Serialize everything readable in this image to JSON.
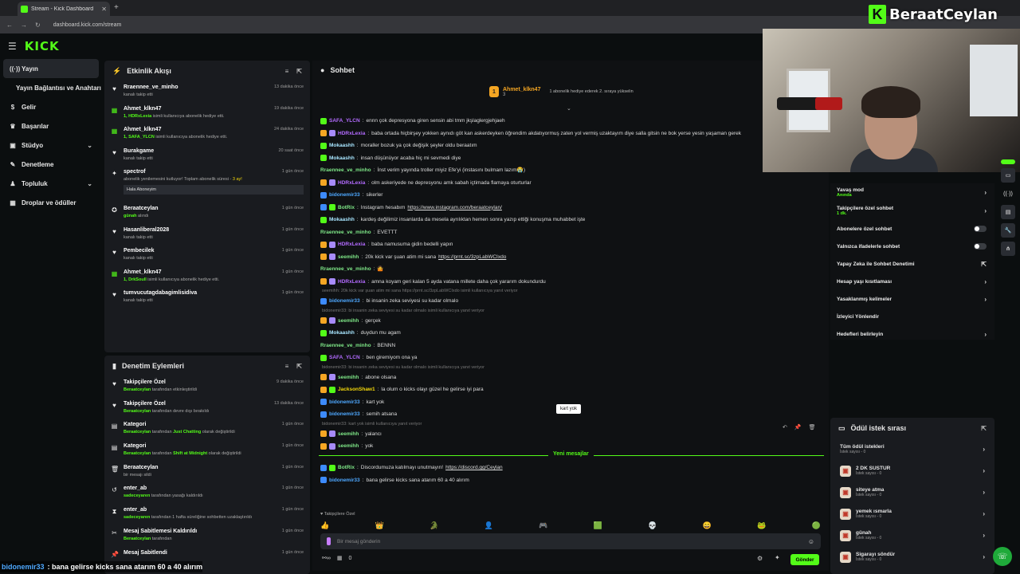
{
  "browser": {
    "tab_title": "Stream - Kick Dashboard",
    "url": "dashboard.kick.com/stream"
  },
  "header": {
    "logo": "KICK"
  },
  "sidebar": {
    "items": [
      {
        "label": "Yayın",
        "icon": "broadcast-icon",
        "active": true
      },
      {
        "label": "Yayın Bağlantısı ve Anahtarı",
        "icon": ""
      },
      {
        "label": "Gelir",
        "icon": "money-icon"
      },
      {
        "label": "Başarılar",
        "icon": "trophy-icon"
      },
      {
        "label": "Stüdyo",
        "icon": "studio-icon",
        "chevron": true
      },
      {
        "label": "Denetleme",
        "icon": "wrench-icon"
      },
      {
        "label": "Topluluk",
        "icon": "community-icon",
        "chevron": true
      },
      {
        "label": "Droplar ve ödüller",
        "icon": "gift-icon"
      }
    ]
  },
  "activity": {
    "title": "Etkinlik Akışı",
    "items": [
      {
        "name": "Rraennee_ve_minho",
        "sub": "kanalı takip etti",
        "time": "13 dakika önce",
        "icon": "heart-icon"
      },
      {
        "name": "Ahmet_klkn47",
        "sub_hl": "1, HDRxLexia",
        "sub": " isimli kullanıcıya abonelik hediye etti.",
        "time": "19 dakika önce",
        "icon": "gift-icon"
      },
      {
        "name": "Ahmet_klkn47",
        "sub_hl": "1, SAFA_YLCN",
        "sub": " isimli kullanıcıya abonelik hediye etti.",
        "time": "24 dakika önce",
        "icon": "gift-icon"
      },
      {
        "name": "Burakgame",
        "sub": "kanalı takip etti",
        "time": "20 saat önce",
        "icon": "heart-icon"
      },
      {
        "name": "spectrof",
        "sub": "abonelik yenilemesini kutluyor! Toplam abonelik süresi - ",
        "sub_tail": "3 ay!",
        "box": "Hala Aboneyim",
        "time": "1 gün önce",
        "icon": "star-icon"
      },
      {
        "name": "Beraatceylan",
        "sub_hl": "günah",
        "sub": " alındı",
        "time": "1 gün önce",
        "icon": "reward-icon"
      },
      {
        "name": "Hasanliberal2028",
        "sub": "kanalı takip etti",
        "time": "1 gün önce",
        "icon": "heart-icon"
      },
      {
        "name": "Pembecilek",
        "sub": "kanalı takip etti",
        "time": "1 gün önce",
        "icon": "heart-icon"
      },
      {
        "name": "Ahmet_klkn47",
        "sub_hl": "1, DrkSoull",
        "sub": " isimli kullanıcıya abonelik hediye etti.",
        "time": "1 gün önce",
        "icon": "gift-icon"
      },
      {
        "name": "tumvucutagdabagimlisidiva",
        "sub": "kanalı takip etti",
        "time": "1 gün önce",
        "icon": "heart-icon"
      }
    ]
  },
  "moderation": {
    "title": "Denetim Eylemleri",
    "items": [
      {
        "name": "Takipçilere Özel",
        "sub_hl": "Beraatceylan",
        "sub": " tarafından etkinleştirildi",
        "time": "9 dakika önce",
        "icon": "heart-icon"
      },
      {
        "name": "Takipçilere Özel",
        "sub_hl": "Beraatceylan",
        "sub": " tarafından devre dışı bırakıldı",
        "time": "13 dakika önce",
        "icon": "heart-icon"
      },
      {
        "name": "Kategori",
        "sub_hl": "Beraatceylan",
        "sub": " tarafından ",
        "sub_hl2": "Just Chatting",
        "sub2": " olarak değiştirildi",
        "time": "1 gün önce",
        "icon": "category-icon"
      },
      {
        "name": "Kategori",
        "sub_hl": "Beraatceylan",
        "sub": " tarafından ",
        "sub_hl2": "Shift at Midnight",
        "sub2": " olarak değiştirildi",
        "time": "1 gün önce",
        "icon": "category-icon"
      },
      {
        "name": "Beraatceylan",
        "sub": "bir mesajı sildi",
        "time": "1 gün önce",
        "icon": "trash-icon"
      },
      {
        "name": "enter_ab",
        "sub_hl": "sadeceyaren",
        "sub": " tarafından yasağı kaldırıldı",
        "time": "1 gün önce",
        "icon": "undo-icon"
      },
      {
        "name": "enter_ab",
        "sub_hl": "sadeceyaren",
        "sub": " tarafından 1 hafta süreliğine sohbetten uzaklaştırıldı",
        "time": "1 gün önce",
        "icon": "hourglass-icon"
      },
      {
        "name": "Mesaj Sabitlemesi Kaldırıldı",
        "sub_hl": "Beraatceylan",
        "sub": " tarafından",
        "time": "1 gün önce",
        "icon": "unpin-icon"
      },
      {
        "name": "Mesaj Sabitlendi",
        "sub": "",
        "time": "1 gün önce",
        "icon": "pin-icon"
      }
    ]
  },
  "chat": {
    "title": "Sohbet",
    "pinned": {
      "user": "Ahmet_klkn47",
      "count": "3",
      "text": "1 abonelik hediye ederek 2. sıraya yükselin"
    },
    "messages": [
      {
        "user": "SAFA_YLCN",
        "color": "#b36bff",
        "text": "ennn çok depresyona giren sensin abi tmm jkşlaglergjehjaeh",
        "badges": [
          "#53fc18"
        ]
      },
      {
        "user": "HDRxLexia",
        "color": "#b36bff",
        "text": "baba ortada hiçbirşey yokken aynıdı göt kan askerdeyken öğrendim akdatıyormuş zaten yol vermiş uzaktayım diye salla gitsin ne bok yerse yesin yaşaman gerek",
        "badges": [
          "#f5a623",
          "#a78bfa"
        ]
      },
      {
        "user": "Mokaashh",
        "color": "#a8e6ff",
        "text": "moraller bozuk ya çok değişik şeyler oldu beraatım",
        "badges": [
          "#53fc18"
        ]
      },
      {
        "user": "Mokaashh",
        "color": "#a8e6ff",
        "text": "insan düşünüyor acaba hiç mi sevmedi diye",
        "badges": [
          "#53fc18"
        ]
      },
      {
        "user": "Rraennee_ve_minho",
        "color": "#7ee787",
        "text": "İnst verim yayında troller miyiz Efe'yi (instasını bulmam lazım😭)",
        "badges": []
      },
      {
        "user": "HDRxLexia",
        "color": "#b36bff",
        "text": "olm askeriyede ne depresyonu amk sabah içtimada flamaya oturturlar",
        "badges": [
          "#f5a623",
          "#a78bfa"
        ]
      },
      {
        "user": "bidonemir33",
        "color": "#4ea8ff",
        "text": "sikerler",
        "badges": [
          "#3d8bfd"
        ]
      },
      {
        "user": "BotRix",
        "color": "#7ee787",
        "text": "Instagram hesabım ",
        "link": "https://www.instagram.com/beraatceylan/",
        "badges": [
          "#3d8bfd",
          "#53fc18"
        ]
      },
      {
        "user": "Mokaashh",
        "color": "#a8e6ff",
        "text": "kardeş değilimiz insanlarda da mesela ayrılıktan hemen sonra yazıp ettiği konuşma muhabbet işte",
        "badges": [
          "#53fc18"
        ]
      },
      {
        "user": "Rraennee_ve_minho",
        "color": "#7ee787",
        "text": "EVETTT",
        "badges": []
      },
      {
        "user": "HDRxLexia",
        "color": "#b36bff",
        "text": "baba namusuma gidin bedelli yapın",
        "badges": [
          "#f5a623",
          "#a78bfa"
        ]
      },
      {
        "user": "seemihh",
        "color": "#7ee787",
        "text": "20k kick var şuan atim mi sana ",
        "link": "https://prnt.sc/3zpLabWCIxdo",
        "badges": [
          "#f5a623",
          "#a78bfa"
        ]
      },
      {
        "user": "Rraennee_ve_minho",
        "color": "#7ee787",
        "text": "🤷",
        "badges": []
      },
      {
        "user": "HDRxLexia",
        "color": "#b36bff",
        "text": "amna koyam geri kalan 5 ayda vatana millete daha çok yararım dokundurdu",
        "badges": [
          "#f5a623",
          "#a78bfa"
        ]
      },
      {
        "reply": "seemihh: 20k kick var şuan atim mi sana https://prnt.sc/3zpLabWCIxdo isimli kullanıcıya yanıt veriyor"
      },
      {
        "user": "bidonemir33",
        "color": "#4ea8ff",
        "text": "bi insanin zeka seviyesi su kadar olmalo",
        "badges": [
          "#3d8bfd"
        ]
      },
      {
        "reply": "bidonemir33: bi insanin zeka seviyesi su kadar olmalo isimli kullanıcıya yanıt veriyor"
      },
      {
        "user": "seemihh",
        "color": "#7ee787",
        "text": "gerçek",
        "badges": [
          "#f5a623",
          "#a78bfa"
        ]
      },
      {
        "user": "Mokaashh",
        "color": "#a8e6ff",
        "text": "duydun mu agam",
        "badges": [
          "#53fc18"
        ]
      },
      {
        "user": "Rraennee_ve_minho",
        "color": "#7ee787",
        "text": "BENNN",
        "badges": []
      },
      {
        "user": "SAFA_YLCN",
        "color": "#b36bff",
        "text": "ben giremiyom ona ya",
        "badges": [
          "#53fc18"
        ]
      },
      {
        "reply": "bidonemir33: bi insanin zeka seviyesi su kadar olmalo isimli kullanıcıya yanıt veriyor"
      },
      {
        "user": "seemihh",
        "color": "#7ee787",
        "text": "abone olsana",
        "badges": [
          "#f5a623",
          "#a78bfa"
        ]
      },
      {
        "user": "JacksonShaw1",
        "color": "#f5d90a",
        "text": "la olum o kicks olayı güzel he gelirse iyi para",
        "badges": [
          "#f5a623",
          "#53fc18"
        ]
      },
      {
        "user": "bidonemir33",
        "color": "#4ea8ff",
        "text": "kart yok",
        "badges": [
          "#3d8bfd"
        ]
      },
      {
        "user": "bidonemir33",
        "color": "#4ea8ff",
        "text": "semih atsana",
        "badges": [
          "#3d8bfd"
        ]
      },
      {
        "reply": "bidonemir33: kart yok isimli kullanıcıya yanıt veriyor"
      },
      {
        "user": "seemihh",
        "color": "#7ee787",
        "text": "yalancı",
        "badges": [
          "#f5a623",
          "#a78bfa"
        ]
      },
      {
        "user": "seemihh",
        "color": "#7ee787",
        "text": "yok",
        "badges": [
          "#f5a623",
          "#a78bfa"
        ]
      }
    ],
    "tooltip": "kart yok",
    "new_messages": "Yeni mesajlar",
    "after": [
      {
        "user": "BotRix",
        "color": "#7ee787",
        "text": "Discordumuza katılmayı unutmayın! ",
        "link": "https://discord.gg/Ceylan",
        "badges": [
          "#3d8bfd",
          "#53fc18"
        ]
      },
      {
        "user": "bidonemir33",
        "color": "#4ea8ff",
        "text": "bana gelirse kicks sana atarım 60 a 40 alırım",
        "badges": [
          "#3d8bfd"
        ]
      }
    ],
    "mode_label": "Takipçilere Özel",
    "placeholder": "Bir mesaj gönderin",
    "send": "Gönder",
    "footer_count": "0"
  },
  "settings": {
    "items": [
      {
        "label": "Yavaş mod",
        "sub": "Anında",
        "type": "chevron"
      },
      {
        "label": "Takipçilere özel sohbet",
        "sub": "1 dk.",
        "type": "chevron"
      },
      {
        "label": "Abonelere özel sohbet",
        "type": "toggle"
      },
      {
        "label": "Yalnızca ifadelerle sohbet",
        "type": "toggle"
      },
      {
        "label": "Yapay Zeka ile Sohbet Denetimi",
        "type": "external"
      },
      {
        "label": "Hesap yaşı kısıtlaması",
        "type": "chevron"
      },
      {
        "label": "Yasaklanmış kelimeler",
        "type": "chevron"
      },
      {
        "label": "İzleyici Yönlendir",
        "type": "none"
      },
      {
        "label": "Hedefleri belirleyin",
        "type": "chevron"
      }
    ]
  },
  "rewards": {
    "title": "Ödül istek sırası",
    "all": "Tüm ödül istekleri",
    "all_sub": "İstek sayısı - 0",
    "items": [
      {
        "label": "2 DK SUSTUR",
        "sub": "İstek sayısı - 0"
      },
      {
        "label": "siteye atma",
        "sub": "İstek sayısı - 0"
      },
      {
        "label": "yemek ısmarla",
        "sub": "İstek sayısı - 0"
      },
      {
        "label": "günah",
        "sub": "İstek sayısı - 0"
      },
      {
        "label": "Sigarayı söndür",
        "sub": "İstek sayısı - 0"
      }
    ]
  },
  "overlay": {
    "brand": "BeraatCeylan",
    "user": "bidonemir33",
    "text": ": bana gelirse kicks sana atarım 60 a 40 alırım"
  }
}
